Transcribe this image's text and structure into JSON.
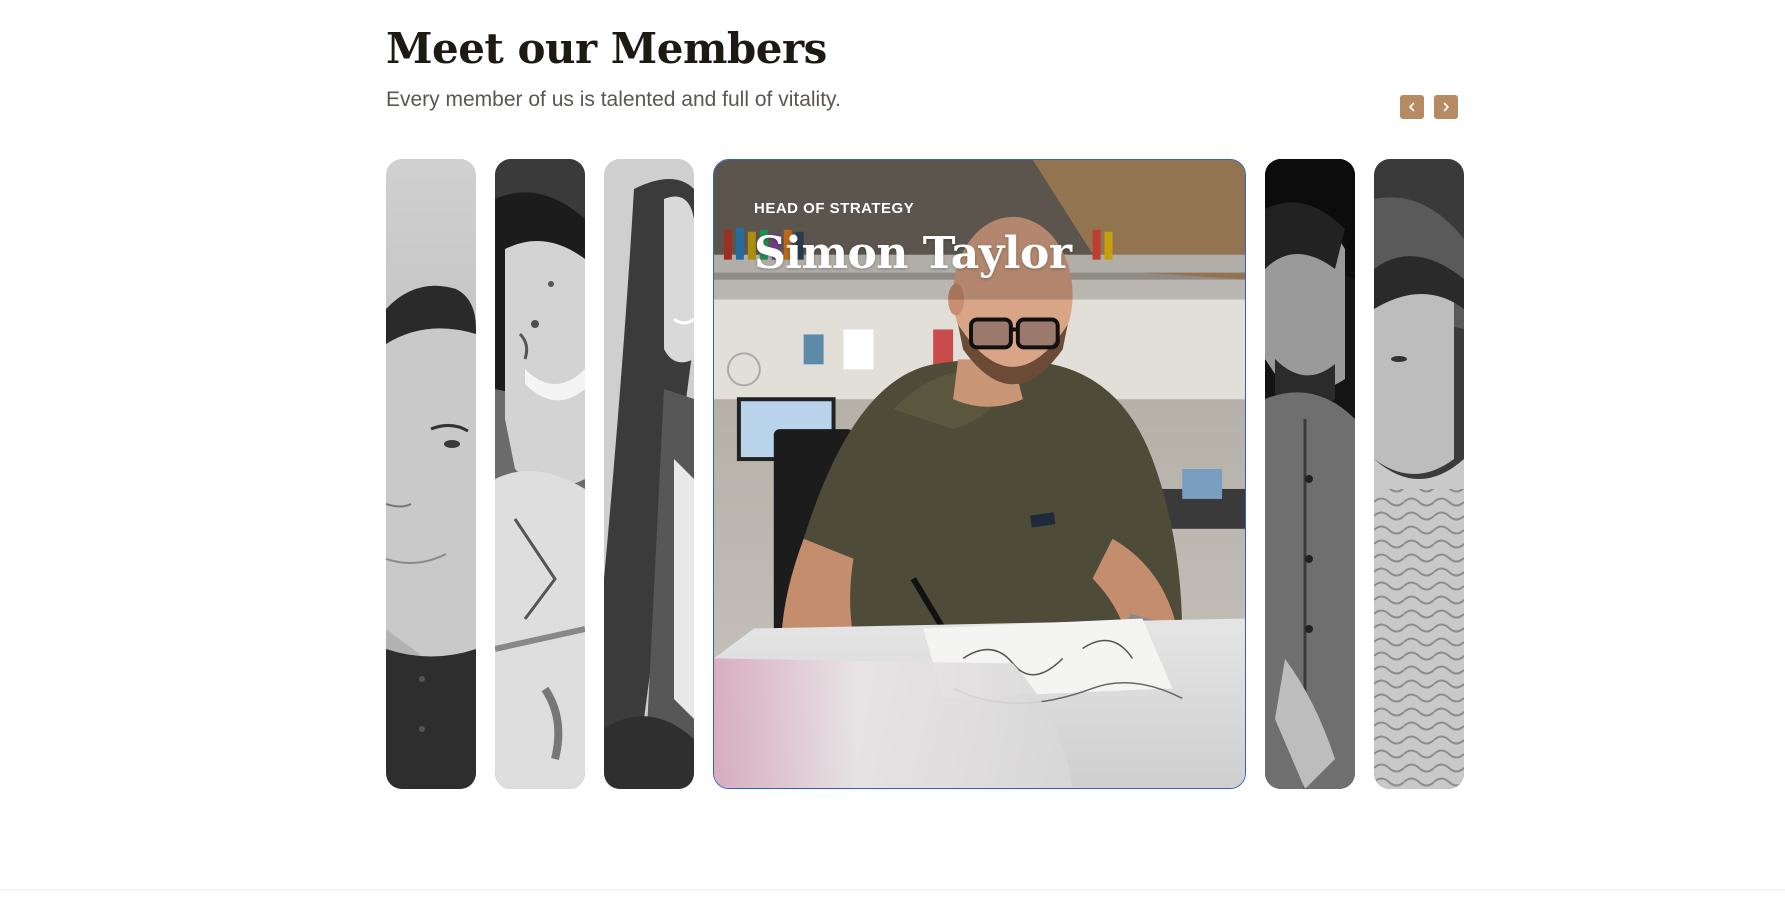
{
  "section": {
    "title": "Meet our Members",
    "subtitle": "Every member of us is talented and full of vitality."
  },
  "navigation": {
    "prev_icon": "chevron-left-icon",
    "next_icon": "chevron-right-icon",
    "button_color": "#b68a63"
  },
  "members": [
    {
      "photo": "portrait-young-man-grayscale"
    },
    {
      "photo": "portrait-smiling-woman-paint-grayscale"
    },
    {
      "photo": "portrait-woman-long-hair-grayscale"
    },
    {
      "role": "HEAD OF STRATEGY",
      "name": "Simon Taylor",
      "photo": "portrait-man-drawing-color",
      "active": true
    },
    {
      "photo": "portrait-man-beard-grayscale"
    },
    {
      "photo": "portrait-young-man-cap-grayscale"
    }
  ],
  "colors": {
    "title": "#1d1a16",
    "subtitle": "#5a5753",
    "active_border": "#2f5fcc"
  }
}
